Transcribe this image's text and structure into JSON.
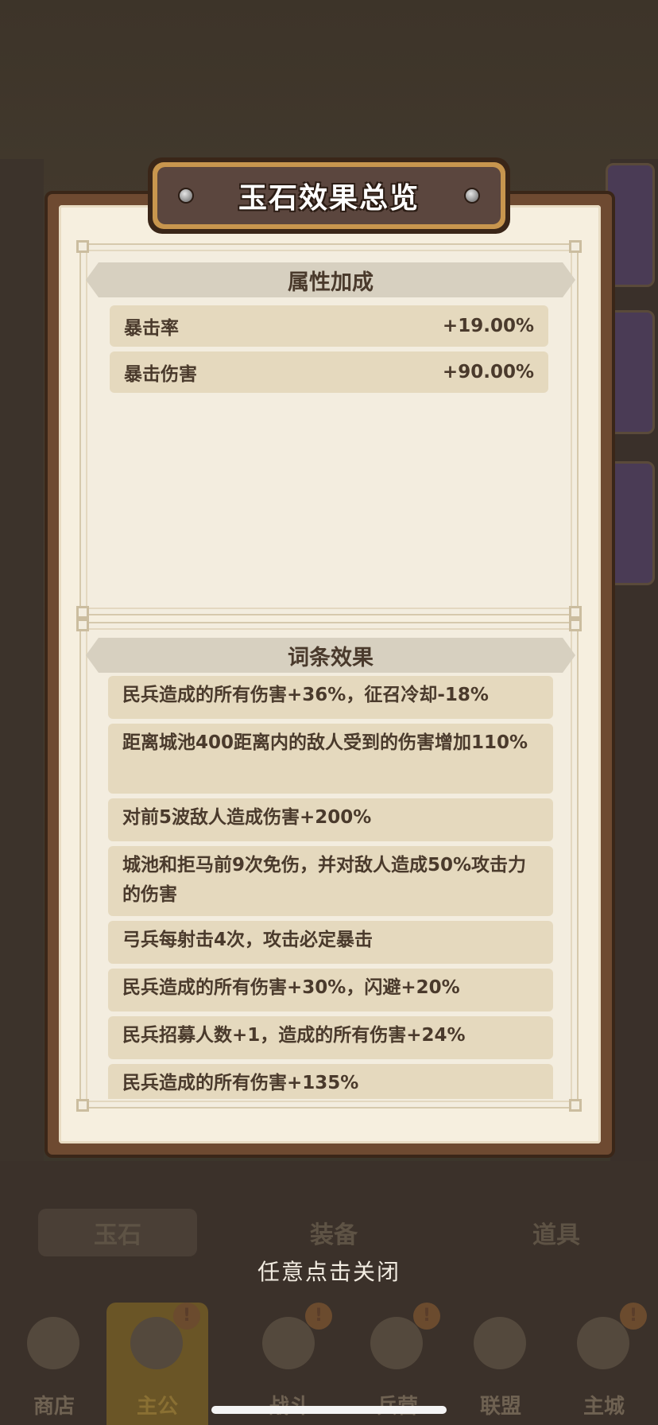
{
  "dialog": {
    "title": "玉石效果总览",
    "attributes_section": {
      "heading": "属性加成",
      "rows": [
        {
          "name": "暴击率",
          "value": "+19.00%"
        },
        {
          "name": "暴击伤害",
          "value": "+90.00%"
        }
      ]
    },
    "effects_section": {
      "heading": "词条效果",
      "items": [
        "民兵造成的所有伤害+36%，征召冷却-18%",
        "距离城池400距离内的敌人受到的伤害增加110%",
        "对前5波敌人造成伤害+200%",
        "城池和拒马前9次免伤，并对敌人造成50%攻击力的伤害",
        "弓兵每射击4次，攻击必定暴击",
        "民兵造成的所有伤害+30%，闪避+20%",
        "民兵招募人数+1，造成的所有伤害+24%",
        "民兵造成的所有伤害+135%"
      ]
    }
  },
  "close_hint": "任意点击关闭",
  "background_tabs": [
    "玉石",
    "装备",
    "道具"
  ],
  "bottom_nav": {
    "items": [
      {
        "label": "商店",
        "icon": "shop-icon"
      },
      {
        "label": "主公",
        "icon": "lord-icon",
        "active": true
      },
      {
        "label": "战斗",
        "icon": "battle-icon"
      },
      {
        "label": "兵营",
        "icon": "barracks-icon"
      },
      {
        "label": "联盟",
        "icon": "alliance-icon"
      },
      {
        "label": "主城",
        "icon": "main-city-icon"
      }
    ]
  },
  "colors": {
    "overlay_bg": "#4a3f33",
    "paper": "#f6efdf",
    "row_bg": "#e5d9be",
    "text": "#4a3a2c",
    "title_plate": "#5b463e"
  }
}
